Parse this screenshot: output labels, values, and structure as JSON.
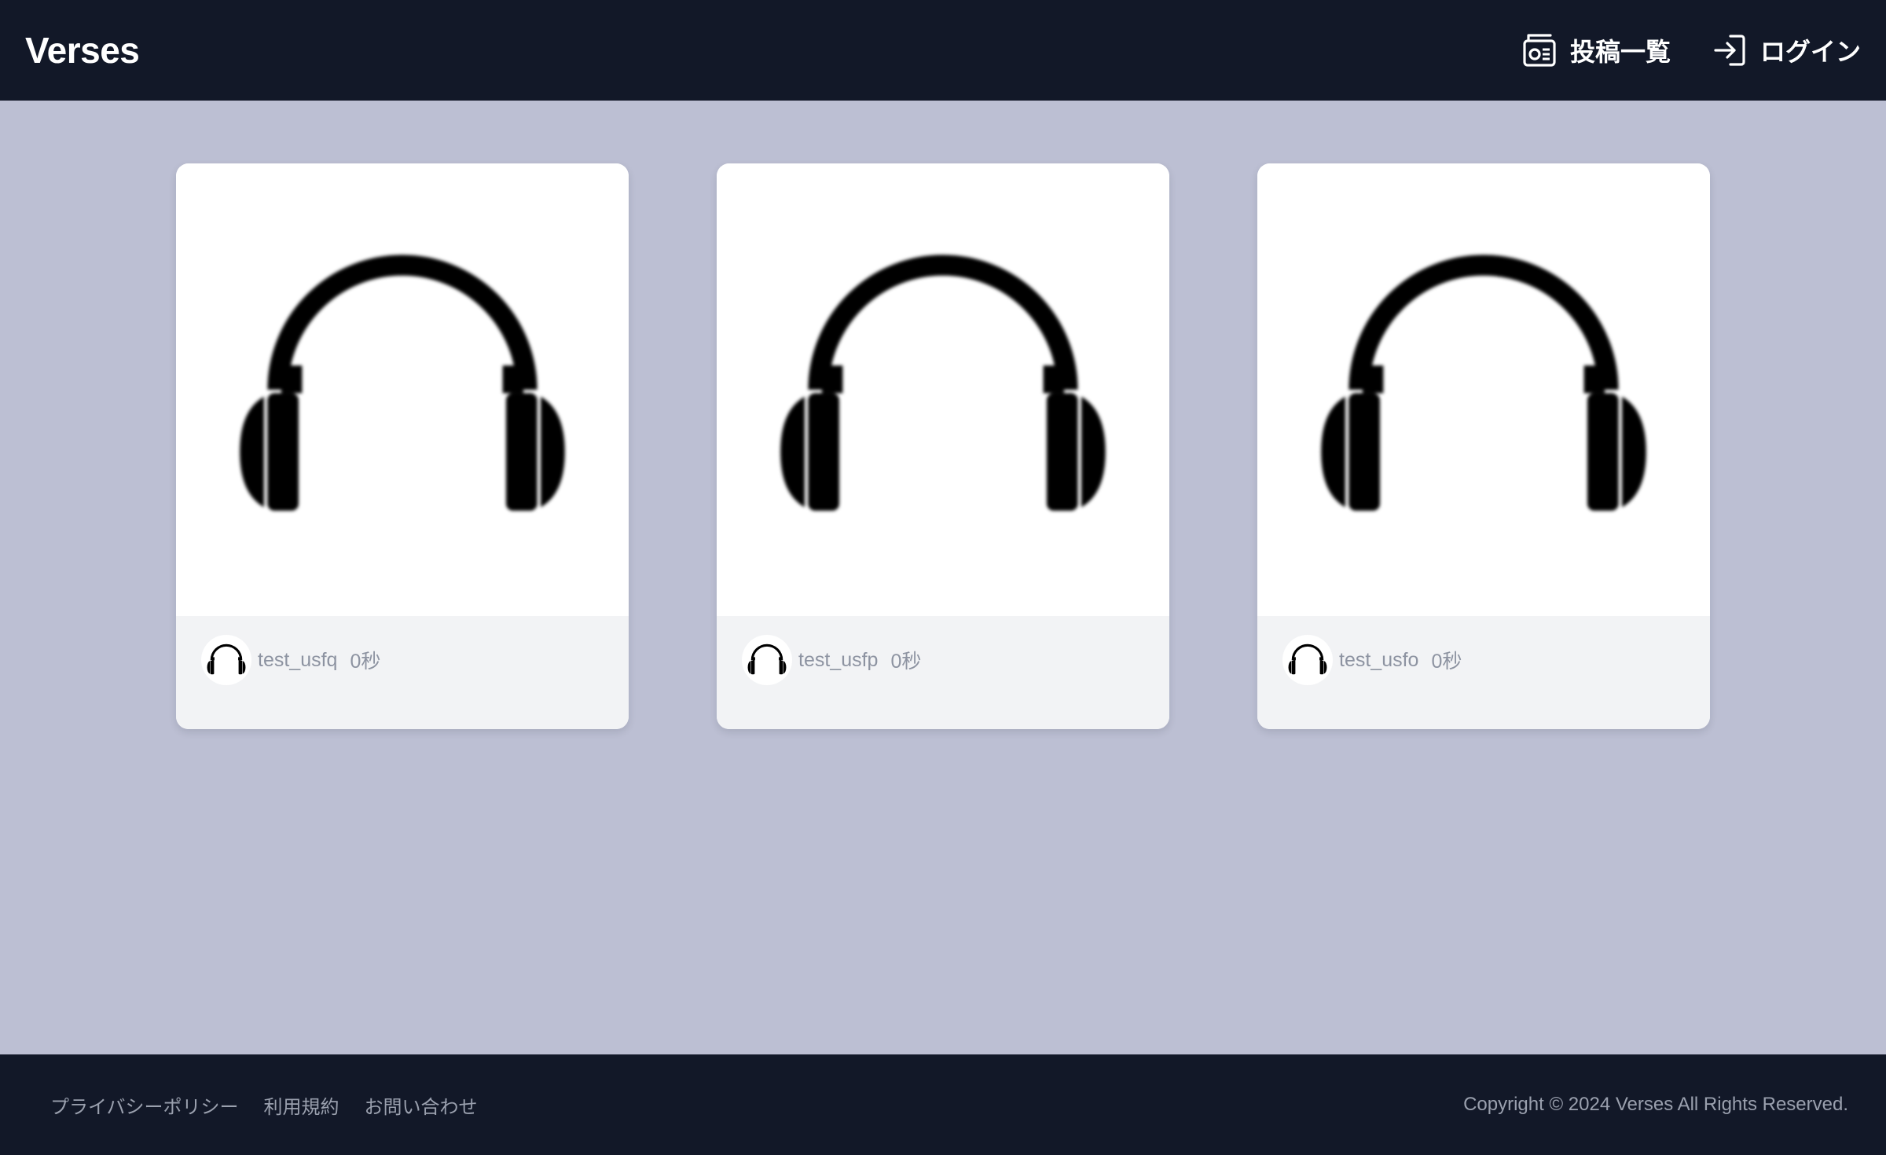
{
  "header": {
    "brand": "Verses",
    "nav": [
      {
        "label": "投稿一覧",
        "icon": "radio-icon"
      },
      {
        "label": "ログイン",
        "icon": "login-icon"
      }
    ]
  },
  "posts": [
    {
      "username": "test_usfq",
      "time": "0秒",
      "image": "headphones-icon",
      "avatar": "headphones-icon"
    },
    {
      "username": "test_usfp",
      "time": "0秒",
      "image": "headphones-icon",
      "avatar": "headphones-icon"
    },
    {
      "username": "test_usfo",
      "time": "0秒",
      "image": "headphones-icon",
      "avatar": "headphones-icon"
    }
  ],
  "footer": {
    "links": [
      "プライバシーポリシー",
      "利用規約",
      "お問い合わせ"
    ],
    "copyright": "Copyright © 2024 Verses All Rights Reserved."
  },
  "colors": {
    "header_bg": "#121828",
    "page_bg": "#bcbfd3",
    "card_footer_bg": "#f2f3f5",
    "muted_text": "#8d93a1"
  }
}
